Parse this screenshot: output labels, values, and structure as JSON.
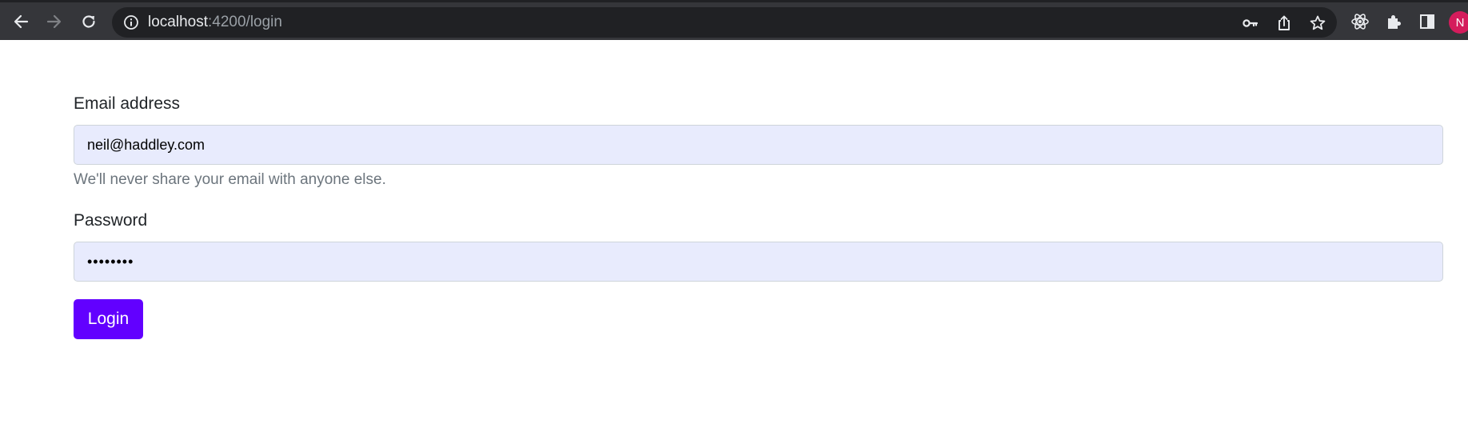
{
  "browser": {
    "url_host": "localhost",
    "url_path": ":4200/login",
    "avatar_letter": "N",
    "colors": {
      "toolbar_bg": "#35363a",
      "omnibox_bg": "#202124",
      "icon": "#e8eaed",
      "icon_disabled": "#7f8185",
      "avatar_bg": "#d41c5c"
    },
    "icons": {
      "back": "back-arrow-icon",
      "forward": "forward-arrow-icon",
      "reload": "reload-icon",
      "site_info": "info-icon",
      "passwords": "key-icon",
      "share": "share-icon",
      "bookmark": "star-icon",
      "react_devtools": "react-icon",
      "extensions": "puzzle-icon",
      "side_panel": "side-panel-icon"
    }
  },
  "form": {
    "email": {
      "label": "Email address",
      "value": "neil@haddley.com",
      "help_text": "We'll never share your email with anyone else."
    },
    "password": {
      "label": "Password",
      "value": "12345678"
    },
    "submit_label": "Login",
    "colors": {
      "input_autofill_bg": "#e8ebfd",
      "button_bg": "#6200ff",
      "label_text": "#212529",
      "help_text": "#6c757d"
    }
  }
}
